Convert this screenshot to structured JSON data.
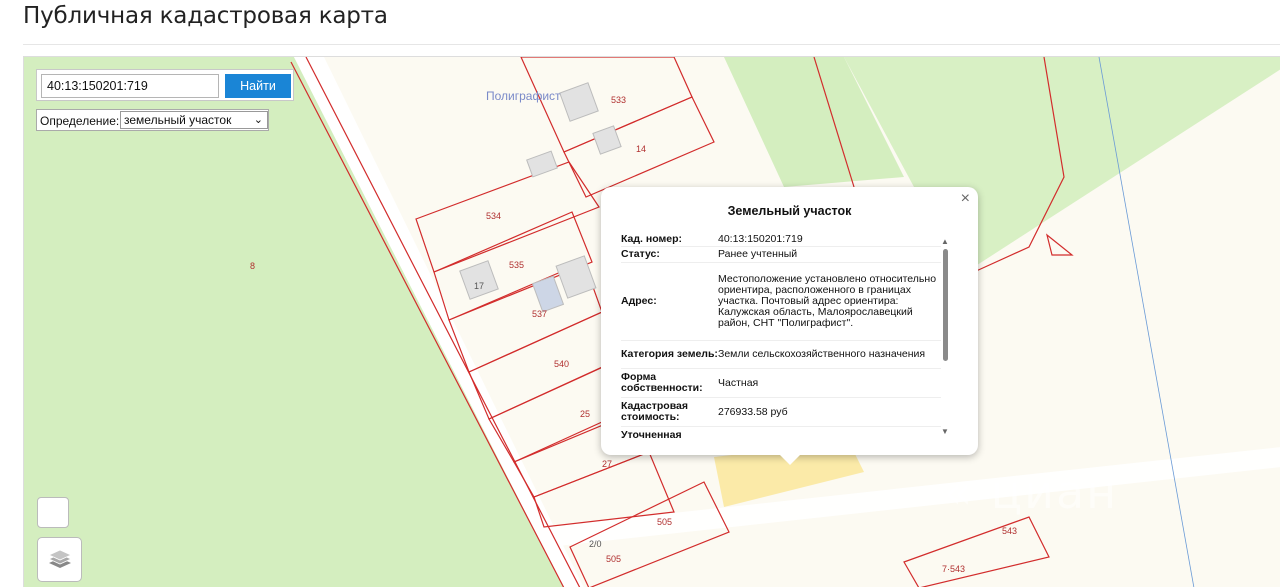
{
  "page": {
    "title": "Публичная кадастровая карта"
  },
  "search": {
    "value": "40:13:150201:719",
    "button_label": "Найти"
  },
  "definition": {
    "label": "Определение:",
    "selected": "земельный участок"
  },
  "map": {
    "place_label": "Полиграфист",
    "parcel_labels": [
      "8",
      "533",
      "14",
      "534",
      "535",
      "17",
      "537",
      "540",
      "25",
      "27",
      "505",
      "505",
      "2/0",
      "543",
      "7·543"
    ],
    "watermark": "« циан"
  },
  "popup": {
    "title": "Земельный участок",
    "close": "×",
    "rows": [
      {
        "key": "Кад. номер:",
        "value": "40:13:150201:719"
      },
      {
        "key": "Статус:",
        "value": "Ранее учтенный"
      },
      {
        "key": "Адрес:",
        "value": "Местоположение установлено относительно ориентира, расположенного в границах участка. Почтовый адрес ориентира: Калужская область, Малоярославецкий район, СНТ \"Полиграфист\"."
      },
      {
        "key": "Категория земель:",
        "value": "Земли сельскохозяйственного назначения"
      },
      {
        "key": "Форма собственности:",
        "value": "Частная"
      },
      {
        "key": "Кадастровая стоимость:",
        "value": "276933.58 руб"
      },
      {
        "key": "Уточненная",
        "value": ""
      }
    ]
  },
  "colors": {
    "forest": "#d4eebf",
    "parcel_line": "#d22c2c",
    "highlight": "#fbe9a3",
    "button": "#1a85d6"
  }
}
